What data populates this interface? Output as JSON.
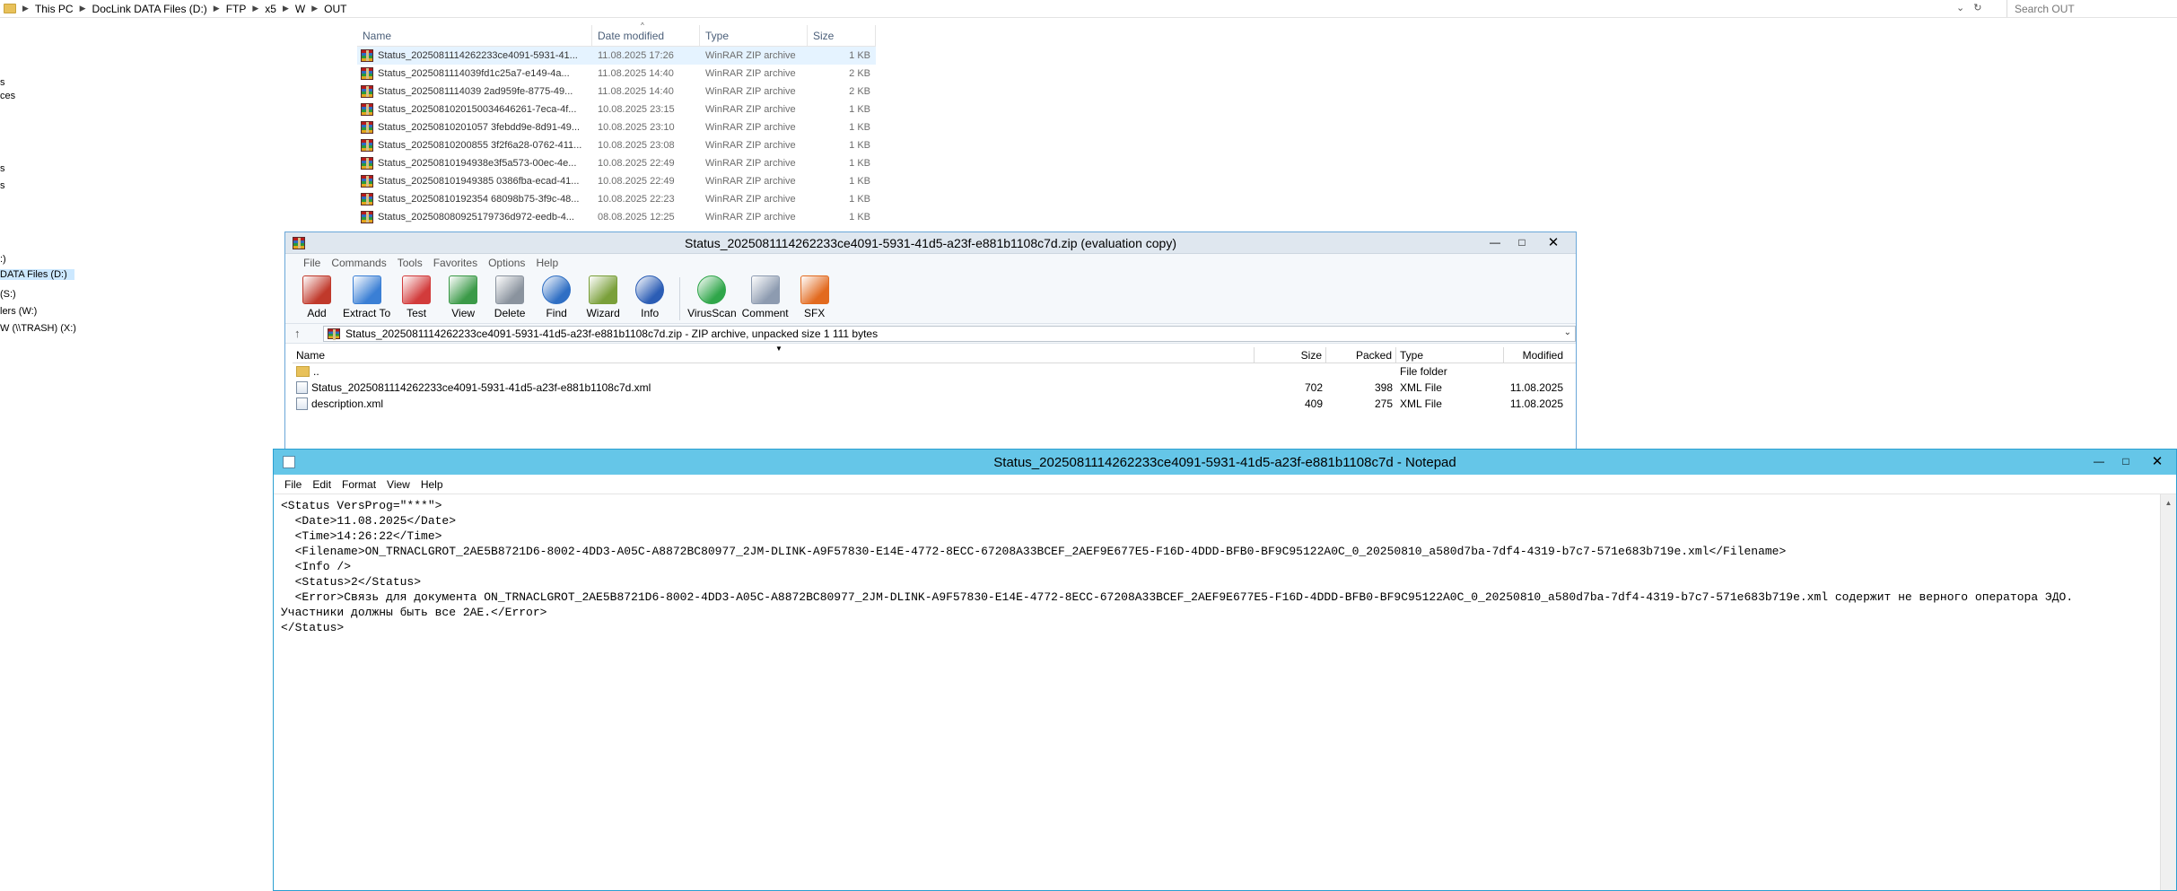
{
  "explorer": {
    "breadcrumb": [
      "This PC",
      "DocLink DATA Files (D:)",
      "FTP",
      "x5",
      "W",
      "OUT"
    ],
    "search_placeholder": "Search OUT",
    "nav_items": [
      {
        "label": "s",
        "selected": false
      },
      {
        "label": "ces",
        "selected": false
      },
      {
        "label": "s",
        "selected": false
      },
      {
        "label": "s",
        "selected": false
      },
      {
        "label": ":)",
        "selected": false
      },
      {
        "label": "DATA Files (D:)",
        "selected": true
      },
      {
        "label": "(S:)",
        "selected": false
      },
      {
        "label": "lers (W:)",
        "selected": false
      },
      {
        "label": "W (\\\\TRASH) (X:)",
        "selected": false
      }
    ],
    "columns": {
      "name": "Name",
      "date": "Date modified",
      "type": "Type",
      "size": "Size"
    },
    "files": [
      {
        "name": "Status_2025081114262233ce4091-5931-41...",
        "date": "11.08.2025 17:26",
        "type": "WinRAR ZIP archive",
        "size": "1 KB",
        "selected": true
      },
      {
        "name": "Status_2025081114039fd1c25a7-e149-4a...",
        "date": "11.08.2025 14:40",
        "type": "WinRAR ZIP archive",
        "size": "2 KB",
        "selected": false
      },
      {
        "name": "Status_2025081114039 2ad959fe-8775-49...",
        "date": "11.08.2025 14:40",
        "type": "WinRAR ZIP archive",
        "size": "2 KB",
        "selected": false
      },
      {
        "name": "Status_2025081020150034646261-7eca-4f...",
        "date": "10.08.2025 23:15",
        "type": "WinRAR ZIP archive",
        "size": "1 KB",
        "selected": false
      },
      {
        "name": "Status_20250810201057 3febdd9e-8d91-49...",
        "date": "10.08.2025 23:10",
        "type": "WinRAR ZIP archive",
        "size": "1 KB",
        "selected": false
      },
      {
        "name": "Status_20250810200855 3f2f6a28-0762-411...",
        "date": "10.08.2025 23:08",
        "type": "WinRAR ZIP archive",
        "size": "1 KB",
        "selected": false
      },
      {
        "name": "Status_20250810194938e3f5a573-00ec-4e...",
        "date": "10.08.2025 22:49",
        "type": "WinRAR ZIP archive",
        "size": "1 KB",
        "selected": false
      },
      {
        "name": "Status_202508101949385 0386fba-ecad-41...",
        "date": "10.08.2025 22:49",
        "type": "WinRAR ZIP archive",
        "size": "1 KB",
        "selected": false
      },
      {
        "name": "Status_20250810192354 68098b75-3f9c-48...",
        "date": "10.08.2025 22:23",
        "type": "WinRAR ZIP archive",
        "size": "1 KB",
        "selected": false
      },
      {
        "name": "Status_202508080925179736d972-eedb-4...",
        "date": "08.08.2025 12:25",
        "type": "WinRAR ZIP archive",
        "size": "1 KB",
        "selected": false
      }
    ]
  },
  "winrar": {
    "title": "Status_2025081114262233ce4091-5931-41d5-a23f-e881b1108c7d.zip (evaluation copy)",
    "menu": [
      "File",
      "Commands",
      "Tools",
      "Favorites",
      "Options",
      "Help"
    ],
    "toolbar": [
      {
        "label": "Add",
        "icon": "add-archive-icon",
        "color": "#c0392b"
      },
      {
        "label": "Extract To",
        "icon": "extract-folder-icon",
        "color": "#3a7fd5"
      },
      {
        "label": "Test",
        "icon": "test-clipboard-icon",
        "color": "#d23b3b"
      },
      {
        "label": "View",
        "icon": "view-book-icon",
        "color": "#3b9a48"
      },
      {
        "label": "Delete",
        "icon": "trash-icon",
        "color": "#8a939e"
      },
      {
        "label": "Find",
        "icon": "magnifier-icon",
        "color": "#2f6fc4"
      },
      {
        "label": "Wizard",
        "icon": "wand-icon",
        "color": "#7aa03a"
      },
      {
        "label": "Info",
        "icon": "info-icon",
        "color": "#2b5db5"
      },
      {
        "label": "VirusScan",
        "icon": "virus-scan-icon",
        "color": "#2fa64a"
      },
      {
        "label": "Comment",
        "icon": "comment-icon",
        "color": "#8d9bb0"
      },
      {
        "label": "SFX",
        "icon": "sfx-box-icon",
        "color": "#e26a1f"
      }
    ],
    "path": "Status_2025081114262233ce4091-5931-41d5-a23f-e881b1108c7d.zip - ZIP archive, unpacked size 1 111 bytes",
    "columns": {
      "name": "Name",
      "size": "Size",
      "packed": "Packed",
      "type": "Type",
      "modified": "Modified"
    },
    "rows": [
      {
        "name": "..",
        "size": "",
        "packed": "",
        "type": "File folder",
        "modified": "",
        "kind": "folder"
      },
      {
        "name": "Status_2025081114262233ce4091-5931-41d5-a23f-e881b1108c7d.xml",
        "size": "702",
        "packed": "398",
        "type": "XML File",
        "modified": "11.08.2025",
        "kind": "xml"
      },
      {
        "name": "description.xml",
        "size": "409",
        "packed": "275",
        "type": "XML File",
        "modified": "11.08.2025",
        "kind": "xml"
      }
    ]
  },
  "notepad": {
    "title": "Status_2025081114262233ce4091-5931-41d5-a23f-e881b1108c7d - Notepad",
    "menu": [
      "File",
      "Edit",
      "Format",
      "View",
      "Help"
    ],
    "lines": [
      "<Status VersProg=\"***\">",
      "  <Date>11.08.2025</Date>",
      "  <Time>14:26:22</Time>",
      "  <Filename>ON_TRNACLGROT_2AE5B8721D6-8002-4DD3-A05C-A8872BC80977_2JM-DLINK-A9F57830-E14E-4772-8ECC-67208A33BCEF_2AEF9E677E5-F16D-4DDD-BFB0-BF9C95122A0C_0_20250810_a580d7ba-7df4-4319-b7c7-571e683b719e.xml</Filename>",
      "  <Info />",
      "  <Status>2</Status>",
      "  <Error>Связь для документа ON_TRNACLGROT_2AE5B8721D6-8002-4DD3-A05C-A8872BC80977_2JM-DLINK-A9F57830-E14E-4772-8ECC-67208A33BCEF_2AEF9E677E5-F16D-4DDD-BFB0-BF9C95122A0C_0_20250810_a580d7ba-7df4-4319-b7c7-571e683b719e.xml содержит не верного оператора ЭДО.",
      "Участники должны быть все 2AE.</Error>",
      "</Status>"
    ]
  }
}
